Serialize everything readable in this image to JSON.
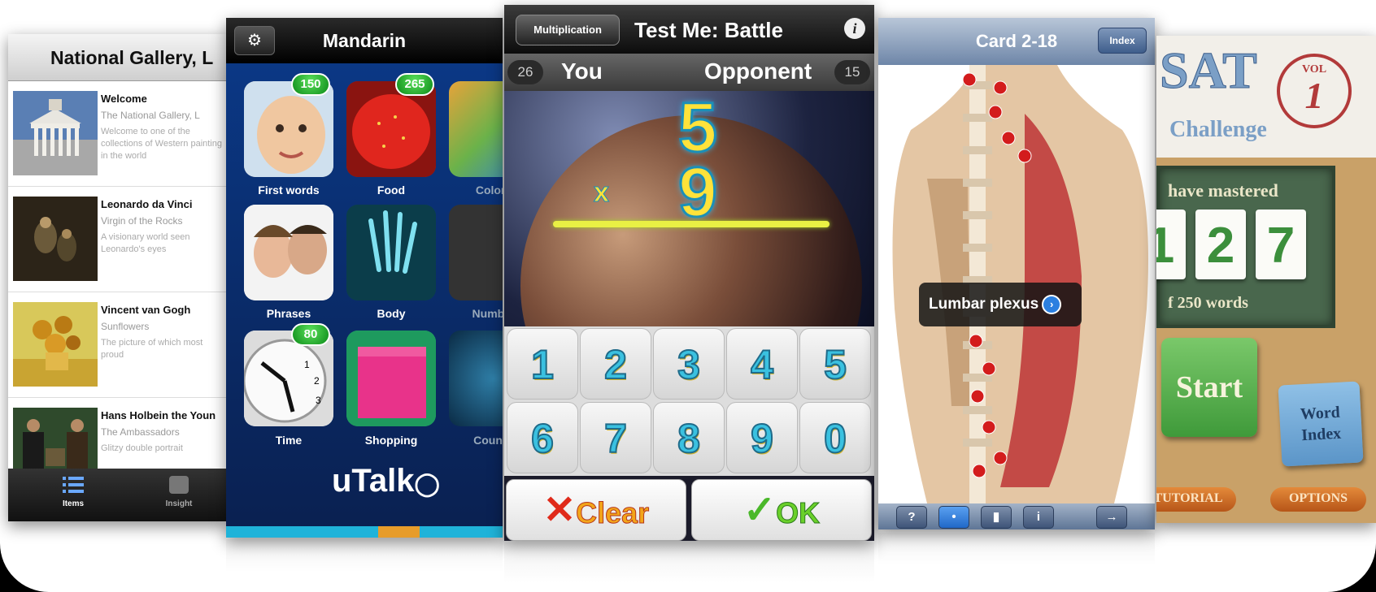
{
  "screens": {
    "gallery": {
      "title": "National Gallery, L",
      "items": [
        {
          "title": "Welcome",
          "subtitle": "The National Gallery, L",
          "desc": "Welcome to one of the collections of Western painting in the world"
        },
        {
          "title": "Leonardo da Vinci",
          "subtitle": "Virgin of the Rocks",
          "desc": "A visionary world seen Leonardo's eyes"
        },
        {
          "title": "Vincent van Gogh",
          "subtitle": "Sunflowers",
          "desc": "The picture of which most proud"
        },
        {
          "title": "Hans Holbein the Youn",
          "subtitle": "The Ambassadors",
          "desc": "Glitzy double portrait"
        }
      ],
      "tabs": [
        {
          "label": "Items"
        },
        {
          "label": "Insight"
        }
      ]
    },
    "mandarin": {
      "title": "Mandarin",
      "tiles": [
        {
          "label": "First words",
          "badge": "150"
        },
        {
          "label": "Food",
          "badge": "265"
        },
        {
          "label": "Colors"
        },
        {
          "label": "Phrases"
        },
        {
          "label": "Body"
        },
        {
          "label": "Number"
        },
        {
          "label": "Time",
          "badge": "80"
        },
        {
          "label": "Shopping"
        },
        {
          "label": "Countri"
        }
      ],
      "logo": "uTalk"
    },
    "battle": {
      "mode_button": "Multiplication",
      "title": "Test Me: Battle",
      "info": "i",
      "you_score": "26",
      "you_label": "You",
      "opponent_label": "Opponent",
      "opponent_score": "15",
      "operand1": "5",
      "operator": "x",
      "operand2": "9",
      "keys": [
        "1",
        "2",
        "3",
        "4",
        "5",
        "6",
        "7",
        "8",
        "9",
        "0"
      ],
      "clear_label": "Clear",
      "ok_label": "OK"
    },
    "anatomy": {
      "title": "Card 2-18",
      "index_button": "Index",
      "callout": "Lumbar plexus",
      "toolbar": [
        "?",
        "•",
        "▮",
        "i",
        "→"
      ]
    },
    "sat": {
      "logo": "SAT",
      "subtitle": "Challenge",
      "vol_label": "VOL",
      "vol_number": "1",
      "mastered_text": "have mastered",
      "digits": [
        "1",
        "2",
        "7"
      ],
      "words_text": "f 250 words",
      "start_label": "Start",
      "word_index_label": "Word Index",
      "tutorial_label": "TUTORIAL",
      "options_label": "OPTIONS"
    }
  },
  "colors": {
    "mandarin_bg": "#0b3a8a",
    "battle_digit": "#ffe23a",
    "sat_board": "#49674d",
    "badge_green": "#1fa22f"
  }
}
